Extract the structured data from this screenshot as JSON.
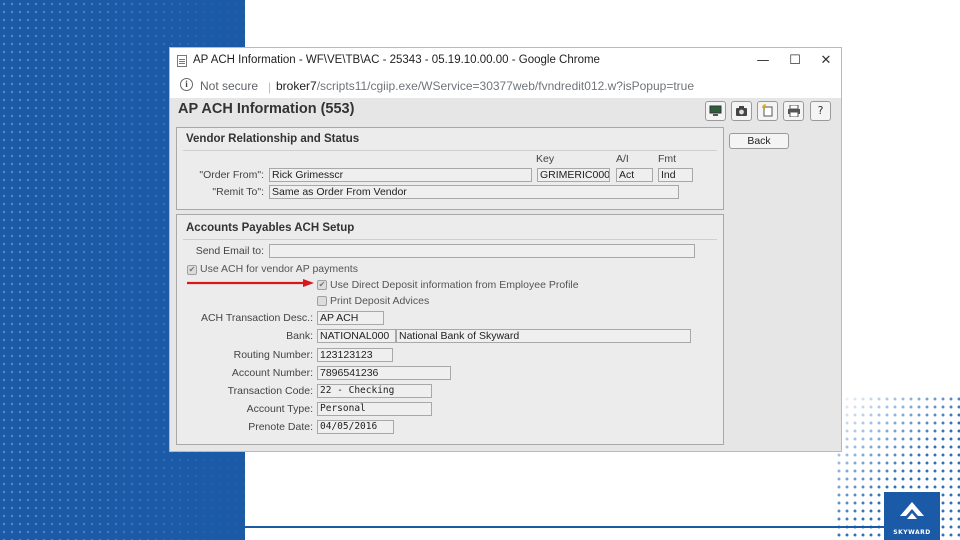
{
  "window": {
    "title": "AP ACH Information - WF\\VE\\TB\\AC - 25343 - 05.19.10.00.00 - Google Chrome",
    "controls": {
      "minimize": "—",
      "maximize": "☐",
      "close": "✕"
    }
  },
  "addressbar": {
    "security": "Not secure",
    "url_host": "broker7",
    "url_path": "/scripts11/cgiip.exe/WService=30377web/fvndredit012.w?isPopup=true"
  },
  "page": {
    "title": "AP ACH Information (553)",
    "back_label": "Back"
  },
  "toolbar": {
    "icons": [
      "monitor-icon",
      "camera-icon",
      "new-document-icon",
      "print-icon",
      "help-icon"
    ],
    "help_label": "?"
  },
  "vendor_section": {
    "title": "Vendor Relationship and Status",
    "col_key": "Key",
    "col_ai": "A/I",
    "col_fmt": "Fmt",
    "order_from_label": "\"Order From\":",
    "order_from_name": "Rick Grimesscr",
    "order_from_key": "GRIMERIC000",
    "order_from_ai": "Act",
    "order_from_fmt": "Ind",
    "remit_to_label": "\"Remit To\":",
    "remit_to_value": "Same as Order From Vendor"
  },
  "ach_section": {
    "title": "Accounts Payables ACH Setup",
    "send_email_label": "Send Email to:",
    "send_email_value": "",
    "use_ach_label": "Use ACH for vendor AP payments",
    "use_ach_checked": true,
    "use_direct_deposit_label": "Use Direct Deposit information from Employee Profile",
    "use_direct_deposit_checked": true,
    "print_advices_label": "Print Deposit Advices",
    "print_advices_checked": false,
    "check_mark": "✔",
    "transaction_desc_label": "ACH Transaction Desc.:",
    "transaction_desc_value": "AP ACH",
    "bank_label": "Bank:",
    "bank_code": "NATIONAL000",
    "bank_name": "National Bank of Skyward",
    "routing_label": "Routing Number:",
    "routing_value": "123123123",
    "account_number_label": "Account Number:",
    "account_number_value": "7896541236",
    "transaction_code_label": "Transaction Code:",
    "transaction_code_value": "22 - Checking",
    "account_type_label": "Account Type:",
    "account_type_value": "Personal",
    "prenote_label": "Prenote Date:",
    "prenote_value": "04/05/2016"
  },
  "annotation": {
    "arrow_color": "#d9161c"
  },
  "branding": {
    "logo_text": "SKYWARD",
    "brand_color": "#1b5aa6"
  }
}
